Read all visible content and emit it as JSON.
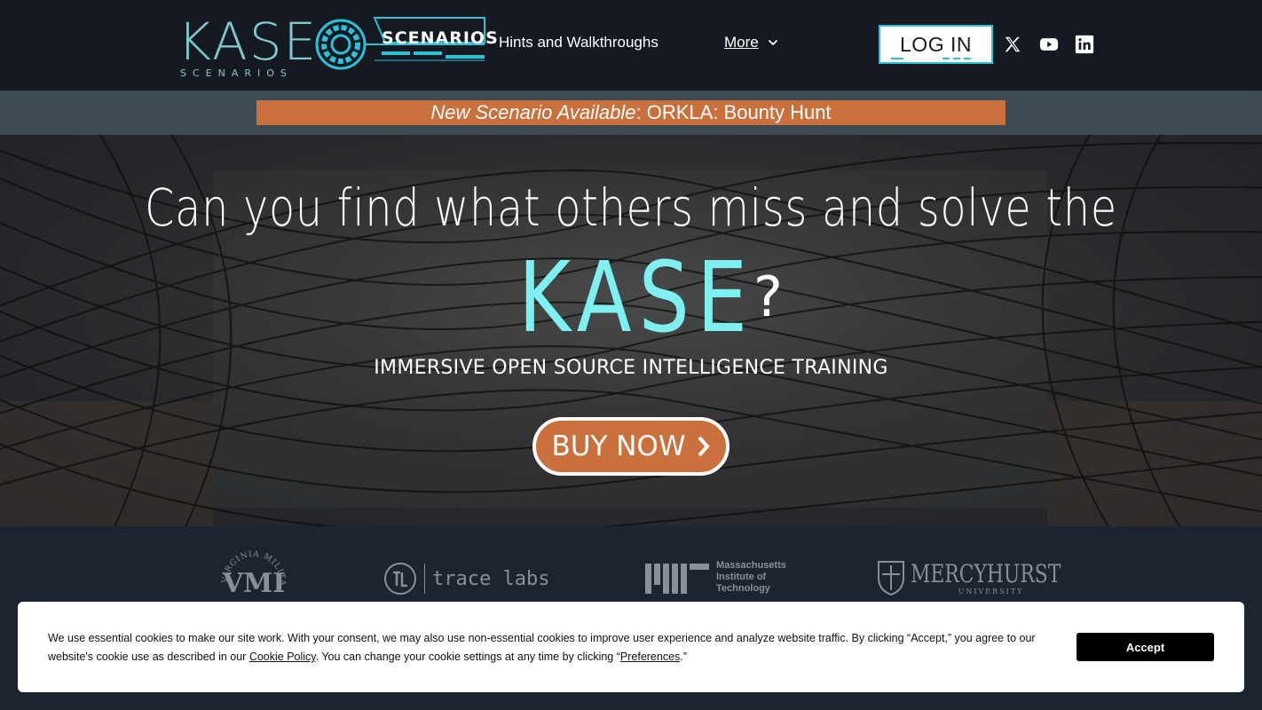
{
  "header": {
    "logo_main": "KASE",
    "logo_sub": "SCENARIOS",
    "logo_badge": "SCENARIOS",
    "nav_hints": "Hints and Walkthroughs",
    "nav_more": "More",
    "login": "LOG IN",
    "social_icons": [
      "x-icon",
      "youtube-icon",
      "linkedin-icon"
    ]
  },
  "banner": {
    "prefix": "New Scenario Available",
    "sep": ": ",
    "title": "ORKLA: Bounty Hunt"
  },
  "hero": {
    "line1": "Can you find what others miss and solve the",
    "kase": "KASE",
    "qmark": "?",
    "subtitle": "IMMERSIVE OPEN SOURCE INTELLIGENCE TRAINING",
    "buy": "BUY NOW"
  },
  "partners": {
    "vmi_arc": "VIRGINIA MILITARY INSTITUTE",
    "trace": "trace labs",
    "mit_line1": "Massachusetts",
    "mit_line2": "Institute of",
    "mit_line3": "Technology",
    "mercy": "MERCYHURST",
    "mercy_sub": "UNIVERSITY"
  },
  "cookie": {
    "text1": "We use essential cookies to make our site work. With your consent, we may also use non-essential cookies to improve user experience and analyze website traffic. By clicking “Accept,” you agree to our website's cookie use as described in our ",
    "policy_link": "Cookie Policy",
    "text2": ". You can change your cookie settings at any time by clicking “",
    "prefs_link": "Preferences",
    "text3": ".”",
    "accept": "Accept"
  },
  "colors": {
    "header_bg": "#151a22",
    "accent_cyan": "#7ef0f2",
    "accent_orange": "#c9703d",
    "logo_teal": "#7ec9cf"
  }
}
